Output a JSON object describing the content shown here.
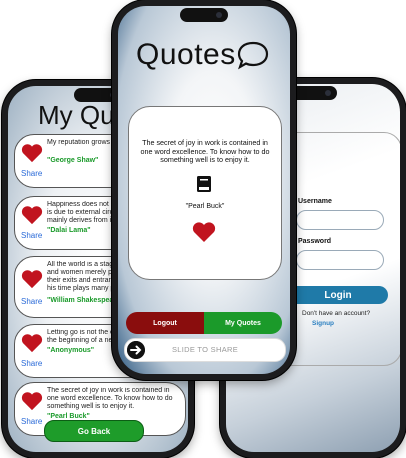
{
  "left_screen": {
    "title": "My Quotes",
    "share_label": "Share",
    "quotes": [
      {
        "text": "My reputation grows with every failure.",
        "author": "\"George Shaw\""
      },
      {
        "text": "Happiness does not come from without, it is due to external circumstances. It is mainly derives from internal attitudes.",
        "author": "\"Dalai Lama\""
      },
      {
        "text": "All the world is a stage, and all the men and women merely players. They have their exits and entrances; And one man in his time plays many parts.",
        "author": "\"William Shakespeare\""
      },
      {
        "text": "Letting go is not the end of the world; it is the beginning of a new life.",
        "author": "\"Anonymous\""
      },
      {
        "text": "The secret of joy in work is contained in one word excellence. To know how to do something well is to enjoy it.",
        "author": "\"Pearl Buck\""
      }
    ],
    "go_back": "Go Back"
  },
  "center_screen": {
    "title": "Quotes",
    "quote_text": "The secret of joy in work is contained in one word excellence. To know how to do something well is to enjoy it.",
    "author": "\"Pearl Buck\"",
    "logout": "Logout",
    "my_quotes": "My Quotes",
    "slide_to_share": "SLIDE TO SHARE"
  },
  "right_screen": {
    "username_label": "Username",
    "password_label": "Password",
    "login_button": "Login",
    "have_account": "Don't have an account?",
    "signup": "Signup"
  },
  "colors": {
    "heart": "#c1141f",
    "logout": "#8a0d0d",
    "my_quotes": "#1b9a2a",
    "login": "#1f7aa8",
    "author_green": "#1a9a2a"
  },
  "icons": [
    "heart-icon",
    "book-icon",
    "speech-bubble-icon",
    "arrow-right-icon"
  ]
}
